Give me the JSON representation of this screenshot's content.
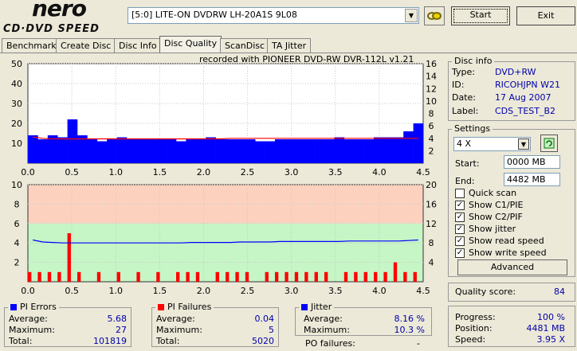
{
  "logo": {
    "brand": "nero",
    "product": "CD·DVD SPEED"
  },
  "toolbar": {
    "drive": "[5:0]  LITE-ON DVDRW LH-20A1S 9L08",
    "start_label": "Start",
    "exit_label": "Exit"
  },
  "tabs": [
    {
      "label": "Benchmark"
    },
    {
      "label": "Create Disc"
    },
    {
      "label": "Disc Info"
    },
    {
      "label": "Disc Quality"
    },
    {
      "label": "ScanDisc"
    },
    {
      "label": "TA Jitter"
    }
  ],
  "chart_caption": "recorded with PIONEER DVD-RW  DVR-112L v1.21",
  "chart_data": [
    {
      "type": "bar",
      "name": "PI errors",
      "xlim": [
        0,
        4.5
      ],
      "ylim": [
        0,
        50
      ],
      "y2lim": [
        0,
        16
      ],
      "x_ticks": [
        "0.0",
        "0.5",
        "1.0",
        "1.5",
        "2.0",
        "2.5",
        "3.0",
        "3.5",
        "4.0",
        "4.5"
      ],
      "y_ticks": [
        "10",
        "20",
        "30",
        "40",
        "50"
      ],
      "y2_ticks": [
        "2",
        "4",
        "6",
        "8",
        "10",
        "12",
        "14",
        "16"
      ],
      "series": [
        {
          "color": "#0000ff",
          "values": [
            14,
            12,
            14,
            13,
            22,
            14,
            12,
            11,
            12,
            13,
            12,
            12,
            12,
            12,
            12,
            11,
            12,
            12,
            13,
            12,
            12,
            12,
            12,
            11,
            11,
            12,
            12,
            12,
            12,
            12,
            12,
            13,
            12,
            12,
            12,
            13,
            13,
            13,
            16,
            20
          ]
        },
        {
          "color": "#ff0000",
          "values": [
            4.2,
            4.0,
            3.9,
            3.9,
            3.9,
            3.9,
            3.9,
            3.9,
            3.9,
            3.9,
            3.9,
            3.9,
            3.9,
            3.9,
            3.9,
            3.9,
            3.9,
            3.9,
            3.9,
            3.9,
            4.0,
            4.0,
            4.0,
            4.0,
            4.0,
            4.0,
            4.0,
            4.0,
            4.0,
            4.0,
            4.0,
            4.0,
            4.0,
            4.0,
            4.0,
            4.0,
            4.0,
            4.0,
            4.0,
            4.0
          ]
        }
      ]
    },
    {
      "type": "bar",
      "name": "PI failures",
      "xlim": [
        0,
        4.5
      ],
      "ylim": [
        0,
        10
      ],
      "y2lim": [
        0,
        20
      ],
      "x_ticks": [
        "0.0",
        "0.5",
        "1.0",
        "1.5",
        "2.0",
        "2.5",
        "3.0",
        "3.5",
        "4.0",
        "4.5"
      ],
      "y_ticks": [
        "2",
        "4",
        "6",
        "8",
        "10"
      ],
      "y2_ticks": [
        "4",
        "8",
        "12",
        "16",
        "20"
      ],
      "series": [
        {
          "color": "#ff0000",
          "values": [
            1,
            1,
            1,
            1,
            5,
            1,
            0,
            1,
            0,
            1,
            0,
            1,
            0,
            1,
            0,
            1,
            1,
            1,
            0,
            1,
            1,
            1,
            1,
            0,
            1,
            1,
            1,
            1,
            1,
            1,
            1,
            0,
            1,
            1,
            1,
            1,
            1,
            2,
            1,
            1
          ]
        },
        {
          "color": "#0000ff",
          "values": [
            8.6,
            8.2,
            8.1,
            8.0,
            8.0,
            8.0,
            8.0,
            8.0,
            8.0,
            8.0,
            8.0,
            8.0,
            8.0,
            8.0,
            8.0,
            8.0,
            8.1,
            8.1,
            8.1,
            8.1,
            8.1,
            8.2,
            8.2,
            8.2,
            8.2,
            8.3,
            8.3,
            8.3,
            8.3,
            8.3,
            8.3,
            8.3,
            8.4,
            8.4,
            8.4,
            8.4,
            8.4,
            8.4,
            8.5,
            8.6
          ]
        }
      ]
    }
  ],
  "disc_info": {
    "title": "Disc info",
    "type_label": "Type:",
    "type": "DVD+RW",
    "id_label": "ID:",
    "id": "RICOHJPN W21",
    "date_label": "Date:",
    "date": "17 Aug 2007",
    "label_label": "Label:",
    "label": "CDS_TEST_B2"
  },
  "settings": {
    "title": "Settings",
    "speed": "4 X",
    "start_label": "Start:",
    "start": "0000 MB",
    "end_label": "End:",
    "end": "4482 MB",
    "checks": [
      {
        "label": "Quick scan",
        "checked": false
      },
      {
        "label": "Show C1/PIE",
        "checked": true
      },
      {
        "label": "Show C2/PIF",
        "checked": true
      },
      {
        "label": "Show jitter",
        "checked": true
      },
      {
        "label": "Show read speed",
        "checked": true
      },
      {
        "label": "Show write speed",
        "checked": true
      }
    ],
    "advanced_label": "Advanced"
  },
  "quality": {
    "label": "Quality score:",
    "value": "84"
  },
  "progress": {
    "progress_label": "Progress:",
    "progress": "100 %",
    "position_label": "Position:",
    "position": "4481 MB",
    "speed_label": "Speed:",
    "speed": "3.95 X"
  },
  "pi_errors": {
    "title": "PI Errors",
    "avg_label": "Average:",
    "avg": "5.68",
    "max_label": "Maximum:",
    "max": "27",
    "total_label": "Total:",
    "total": "101819"
  },
  "pi_failures": {
    "title": "PI Failures",
    "avg_label": "Average:",
    "avg": "0.04",
    "max_label": "Maximum:",
    "max": "5",
    "total_label": "Total:",
    "total": "5020"
  },
  "jitter": {
    "title": "Jitter",
    "avg_label": "Average:",
    "avg": "8.16 %",
    "max_label": "Maximum:",
    "max": "10.3 %",
    "po_label": "PO failures:",
    "po": "-"
  }
}
